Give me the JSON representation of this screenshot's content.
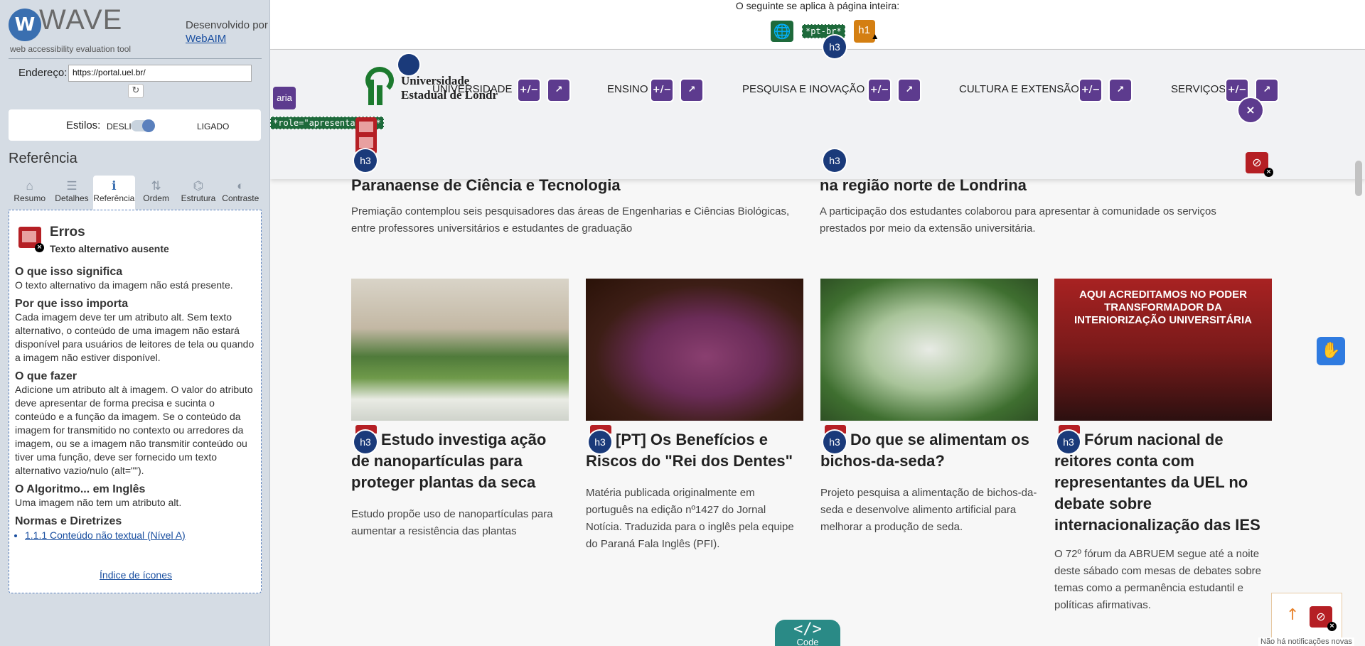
{
  "wave": {
    "logo_letter": "W",
    "brand": "WAVE",
    "tagline": "web accessibility evaluation tool",
    "developed_by": "Desenvolvido por",
    "developer_link": "WebAIM",
    "address_label": "Endereço:",
    "address_value": "https://portal.uel.br/",
    "reload_glyph": "↻",
    "styles_label": "Estilos:",
    "styles_off": "DESLIGA",
    "styles_on": "LIGADO",
    "section_title": "Referência",
    "tabs": [
      {
        "label": "Resumo",
        "glyph": "⌂"
      },
      {
        "label": "Detalhes",
        "glyph": "☰"
      },
      {
        "label": "Referência",
        "glyph": "ℹ"
      },
      {
        "label": "Ordem",
        "glyph": "⇅"
      },
      {
        "label": "Estrutura",
        "glyph": "⌬"
      },
      {
        "label": "Contraste",
        "glyph": "◐"
      }
    ],
    "reference": {
      "category": "Erros",
      "item": "Texto alternativo ausente",
      "what_title": "O que isso significa",
      "what_text": "O texto alternativo da imagem não está presente.",
      "why_title": "Por que isso importa",
      "why_text": "Cada imagem deve ter um atributo alt. Sem texto alternativo, o conteúdo de uma imagem não estará disponível para usuários de leitores de tela ou quando a imagem não estiver disponível.",
      "do_title": "O que fazer",
      "do_text": "Adicione um atributo alt à imagem. O valor do atributo deve apresentar de forma precisa e sucinta o conteúdo e a função da imagem. Se o conteúdo da imagem for transmitido no contexto ou arredores da imagem, ou se a imagem não transmitir conteúdo ou tiver uma função, deve ser fornecido um texto alternativo vazio/nulo (alt=\"\").",
      "algo_title": "O Algoritmo... em Inglês",
      "algo_text": "Uma imagem não tem um atributo alt.",
      "norms_title": "Normas e Diretrizes",
      "norm_link": "1.1.1 Conteúdo não textual (Nível A)",
      "icon_index": "Índice de ícones"
    }
  },
  "page": {
    "summary_text": "O seguinte se aplica à página inteira:",
    "lang_badge": "*pt-br*",
    "h1_badge": "h1",
    "aria_badge": "aria",
    "role_badge": "*role=\"apresentação\"*",
    "h3_badge": "h3",
    "expand_badge": "+/−",
    "logo_line1": "Universidade",
    "logo_line2": "Estadual de Londr",
    "nav": [
      "UNIVERSIDADE",
      "ENSINO",
      "PESQUISA E INOVAÇÃO",
      "CULTURA E EXTENSÃO",
      "SERVIÇOS"
    ],
    "top_news": [
      {
        "title": "Paranaense de Ciência e Tecnologia",
        "desc": "Premiação contemplou seis pesquisadores das áreas de Engenharias e Ciências Biológicas, entre professores universitários e estudantes de graduação"
      },
      {
        "title": "na região norte de Londrina",
        "desc": "A participação dos estudantes colaborou para apresentar à comunidade os serviços prestados por meio da extensão universitária."
      }
    ],
    "cards": [
      {
        "title": "Estudo investiga ação de nanopartículas para proteger plantas da seca",
        "desc": "Estudo propõe uso de nanopartículas para aumentar a resistência das plantas"
      },
      {
        "title": "[PT] Os Benefícios e Riscos do \"Rei dos Dentes\"",
        "desc": "Matéria publicada originalmente em português na edição nº1427 do Jornal Notícia. Traduzida para o inglês pela equipe do Paraná Fala Inglês (PFI)."
      },
      {
        "title": "Do que se alimentam os bichos-da-seda?",
        "desc": "Projeto pesquisa a alimentação de bichos-da-seda e desenvolve alimento artificial para melhorar a produção de seda."
      },
      {
        "title": "Fórum nacional de reitores conta com representantes da UEL no debate sobre internacionalização das IES",
        "desc": "O 72º fórum da ABRUEM segue até a noite deste sábado com mesas de debates sobre temas como a permanência estudantil e políticas afirmativas."
      }
    ],
    "card4_image_text": "AQUI ACREDITAMOS NO PODER TRANSFORMADOR DA INTERIORIZAÇÃO UNIVERSITÁRIA",
    "code_glyph": "</>",
    "code_label": "Code",
    "notification_text": "Não há notificações novas"
  }
}
